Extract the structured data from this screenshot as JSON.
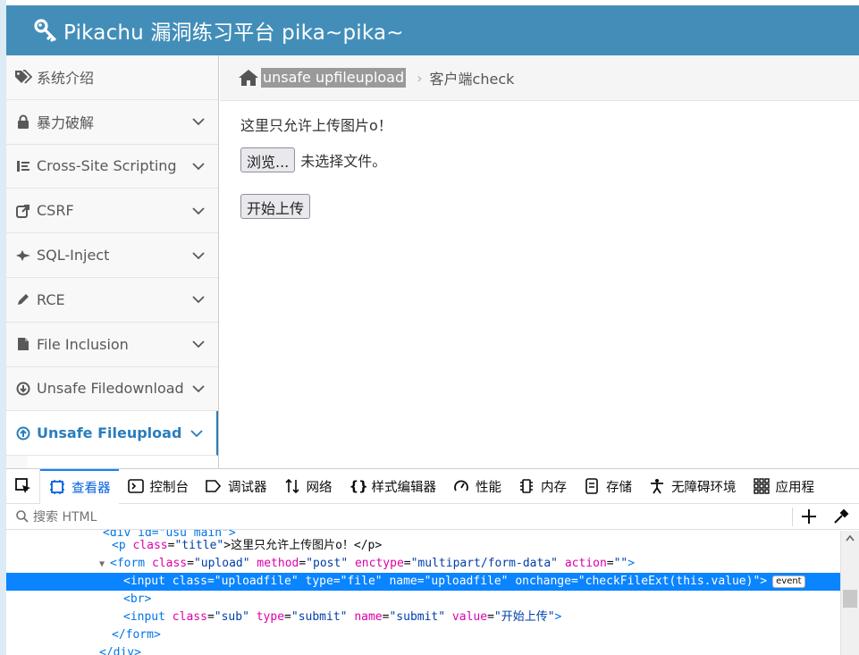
{
  "header": {
    "title": "Pikachu 漏洞练习平台 pika~pika~"
  },
  "sidebar": {
    "items": [
      {
        "label": "系统介绍",
        "icon": "tags-icon",
        "has_chevron": false
      },
      {
        "label": "暴力破解",
        "icon": "lock-icon",
        "has_chevron": true
      },
      {
        "label": "Cross-Site Scripting",
        "icon": "list-tree-icon",
        "has_chevron": true
      },
      {
        "label": "CSRF",
        "icon": "share-icon",
        "has_chevron": true
      },
      {
        "label": "SQL-Inject",
        "icon": "fighter-jet-icon",
        "has_chevron": true
      },
      {
        "label": "RCE",
        "icon": "pencil-icon",
        "has_chevron": true
      },
      {
        "label": "File Inclusion",
        "icon": "file-icon",
        "has_chevron": true
      },
      {
        "label": "Unsafe Filedownload",
        "icon": "download-circle-icon",
        "has_chevron": true
      },
      {
        "label": "Unsafe Fileupload",
        "icon": "upload-circle-icon",
        "has_chevron": true,
        "active": true
      }
    ]
  },
  "breadcrumbs": {
    "section": "unsafe upfileupload",
    "page": "客户端check"
  },
  "main": {
    "title": "这里只允许上传图片o！",
    "browse_label": "浏览...",
    "file_status": "未选择文件。",
    "submit_label": "开始上传"
  },
  "devtools": {
    "tabs": [
      {
        "label": "查看器",
        "icon": "inspector-icon",
        "selected": true
      },
      {
        "label": "控制台",
        "icon": "console-icon"
      },
      {
        "label": "调试器",
        "icon": "debugger-icon"
      },
      {
        "label": "网络",
        "icon": "network-icon"
      },
      {
        "label": "样式编辑器",
        "icon": "style-editor-icon"
      },
      {
        "label": "性能",
        "icon": "performance-icon"
      },
      {
        "label": "内存",
        "icon": "memory-icon"
      },
      {
        "label": "存储",
        "icon": "storage-icon"
      },
      {
        "label": "无障碍环境",
        "icon": "accessibility-icon"
      },
      {
        "label": "应用程",
        "icon": "application-icon"
      }
    ],
    "search_placeholder": "搜索 HTML",
    "event_badge": "event",
    "code": {
      "l0": "<div id=\"usu_main\">",
      "p_tag_open": "<p",
      "p_attr": "class",
      "p_attr_val": "\"title\"",
      "p_text": ">这里只允许上传图片o！</p>",
      "form_tag": "<form",
      "form_a1": "class",
      "form_v1": "\"upload\"",
      "form_a2": "method",
      "form_v2": "\"post\"",
      "form_a3": "enctype",
      "form_v3": "\"multipart/form-data\"",
      "form_a4": "action",
      "form_v4": "\"\"",
      "input_tag": "<input",
      "input_a1": "class",
      "input_v1": "\"uploadfile\"",
      "input_a2": "type",
      "input_v2": "\"file\"",
      "input_a3": "name",
      "input_v3": "\"uploadfile\"",
      "input_a4": "onchange",
      "input_v4": "\"checkFileExt(this.value)\"",
      "br": "<br>",
      "sub_tag": "<input",
      "sub_a1": "class",
      "sub_v1": "\"sub\"",
      "sub_a2": "type",
      "sub_v2": "\"submit\"",
      "sub_a3": "name",
      "sub_v3": "\"submit\"",
      "sub_a4": "value",
      "sub_v4": "\"开始上传\"",
      "form_close": "</form>",
      "div_close": "</div>"
    }
  },
  "colors": {
    "header": "#438eb9",
    "active_nav": "#2b7dbc",
    "devtools_selection": "#0a84ff"
  }
}
